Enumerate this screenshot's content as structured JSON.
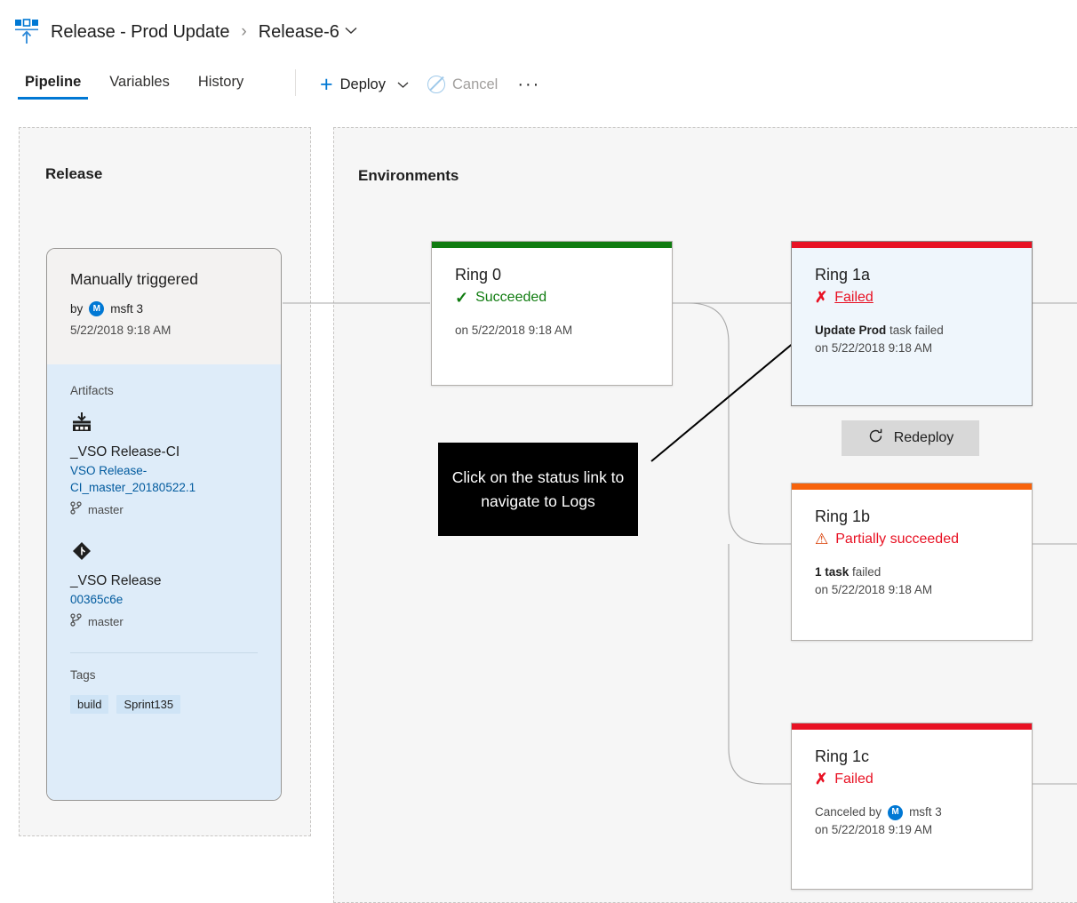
{
  "header": {
    "icon": "release-pipeline-icon",
    "breadcrumb_root": "Release - Prod Update",
    "breadcrumb_separator": "›",
    "breadcrumb_current": "Release-6",
    "chevron": "⌄"
  },
  "toolbar": {
    "tabs": [
      {
        "label": "Pipeline",
        "active": true
      },
      {
        "label": "Variables",
        "active": false
      },
      {
        "label": "History",
        "active": false
      }
    ],
    "deploy_label": "Deploy",
    "deploy_plus": "+",
    "deploy_chevron": "∨",
    "cancel_label": "Cancel",
    "cancel_disabled": true,
    "more_label": "···"
  },
  "release_panel": {
    "title": "Release",
    "card": {
      "trigger": "Manually triggered",
      "by_label": "by",
      "by_user": "msft 3",
      "avatar_initial": "M",
      "date": "5/22/2018 9:18 AM",
      "artifacts_label": "Artifacts",
      "artifacts": [
        {
          "icon": "build-artifact-icon",
          "name": "_VSO Release-CI",
          "version": "VSO Release-CI_master_20180522.1",
          "branch": "master"
        },
        {
          "icon": "git-repo-icon",
          "name": "_VSO Release",
          "version": "00365c6e",
          "branch": "master"
        }
      ],
      "tags_label": "Tags",
      "tags": [
        "build",
        "Sprint135"
      ]
    }
  },
  "environments_panel": {
    "title": "Environments",
    "cards": [
      {
        "name": "Ring 0",
        "status": "Succeeded",
        "status_icon": "check-icon",
        "status_color": "#107c10",
        "bar_color": "#107c10",
        "meta_bold": "",
        "meta_rest": "",
        "meta_line2": "on 5/22/2018 9:18 AM",
        "selected": false,
        "status_is_link": false
      },
      {
        "name": "Ring 1a",
        "status": "Failed",
        "status_icon": "x-icon",
        "status_color": "#e81123",
        "bar_color": "#e81123",
        "meta_bold": "Update Prod",
        "meta_rest": " task failed",
        "meta_line2": "on 5/22/2018 9:18 AM",
        "selected": true,
        "status_is_link": true
      },
      {
        "name": "Ring 1b",
        "status": "Partially succeeded",
        "status_icon": "warning-icon",
        "status_color": "#e81123",
        "bar_color": "#f7630c",
        "meta_bold": "1 task",
        "meta_rest": " failed",
        "meta_line2": "on 5/22/2018 9:18 AM",
        "selected": false,
        "status_is_link": false
      },
      {
        "name": "Ring 1c",
        "status": "Failed",
        "status_icon": "x-icon",
        "status_color": "#e81123",
        "bar_color": "#e81123",
        "meta_bold": "",
        "meta_rest": "Canceled by",
        "meta_user": "msft 3",
        "meta_avatar": "M",
        "meta_line2": "on 5/22/2018 9:19 AM",
        "selected": false,
        "status_is_link": false
      }
    ],
    "redeploy_label": "Redeploy",
    "redeploy_icon": "refresh-icon"
  },
  "callout": {
    "text": "Click on the status link to navigate to Logs",
    "background": "#000000",
    "color": "#ffffff"
  },
  "colors": {
    "accent": "#0078d4",
    "success": "#107c10",
    "error": "#e81123",
    "warning": "#f7630c",
    "selected_card_bg": "#eff6fc",
    "panel_bg": "#f6f6f6"
  }
}
